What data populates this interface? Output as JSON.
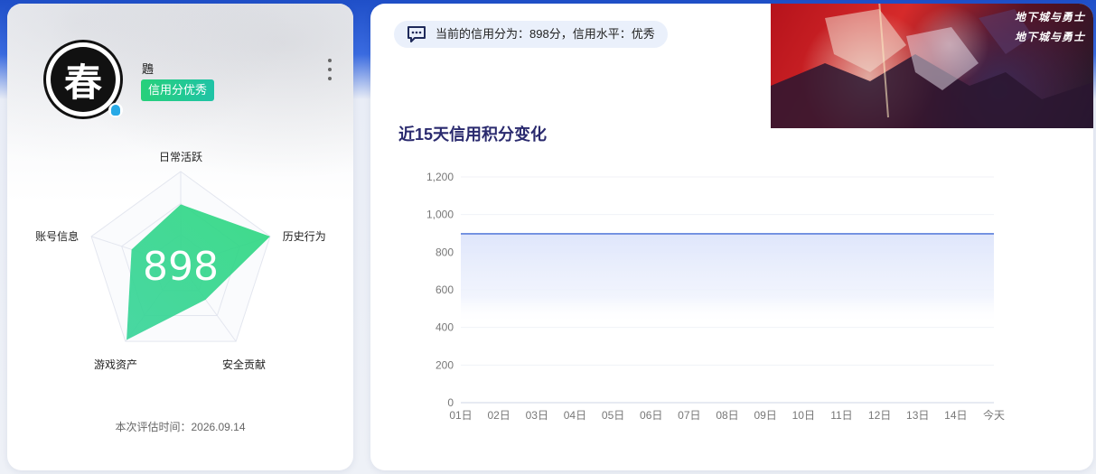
{
  "profile": {
    "avatar_char": "春",
    "username": "鶗",
    "credit_tag": "信用分优秀",
    "avatar_icon": "avatar",
    "badge_icon": "qq-icon",
    "more_icon": "more-vertical-icon"
  },
  "radar": {
    "score": "898",
    "dimensions": [
      "日常活跃",
      "历史行为",
      "安全贡献",
      "游戏资产",
      "账号信息"
    ],
    "values": [
      0.65,
      1.0,
      0.45,
      0.98,
      0.55
    ],
    "fill_start": "#2fd38a",
    "fill_end": "#3cd6a0"
  },
  "eval_time": "本次评估时间：2026.09.14",
  "summary": {
    "text": "当前的信用分为：898分，信用水平：优秀",
    "icon": "message-icon"
  },
  "banner": {
    "logo_top": "地下城与勇士",
    "logo_bottom": "地下城与勇士"
  },
  "chart_data": {
    "type": "area",
    "title": "近15天信用积分变化",
    "x": [
      "01日",
      "02日",
      "03日",
      "04日",
      "05日",
      "06日",
      "07日",
      "08日",
      "09日",
      "10日",
      "11日",
      "12日",
      "13日",
      "14日",
      "今天"
    ],
    "series": [
      {
        "values": [
          898,
          898,
          898,
          898,
          898,
          898,
          898,
          898,
          898,
          898,
          898,
          898,
          898,
          898,
          898
        ]
      }
    ],
    "ylim": [
      0,
      1200
    ],
    "yticks": [
      "0",
      "200",
      "400",
      "600",
      "800",
      "1,000",
      "1,200"
    ],
    "grid": true,
    "line_color": "#5b7fdb",
    "fill_color": "#dfe6fb"
  }
}
